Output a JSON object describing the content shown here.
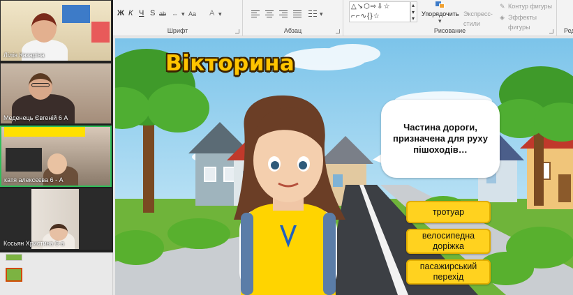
{
  "video_call": {
    "participants": [
      {
        "name": "Лілія Казаріна"
      },
      {
        "name": "Меденець Євгеній 6 А"
      },
      {
        "name": "катя алексєєва 6 - А"
      },
      {
        "name": "Косьян Христина 6-а"
      }
    ],
    "colors": {
      "active_speaker_border": "#2fbf5a"
    }
  },
  "ribbon": {
    "font_group": {
      "label": "Шрифт",
      "glyphs": [
        "Ж",
        "К",
        "Ч",
        "S",
        "ab",
        "А"
      ]
    },
    "paragraph_group": {
      "label": "Абзац"
    },
    "drawing_group": {
      "label": "Рисование",
      "arrange_label": "Упорядочить",
      "express_styles_label": "Экспресс-стили",
      "shape_outline_label": "Контур фигуры",
      "shape_effects_label": "Эффекты фигуры"
    },
    "truncated_group_label": "Ред"
  },
  "slide": {
    "title": "Вікторина",
    "question": "Частина дороги, призначена для руху пішоходів…",
    "answers": [
      "тротуар",
      "велосипедна доріжка",
      "пасажирський перехід"
    ],
    "colors": {
      "title": "#ffc400",
      "answer_fill": "#ffd21f",
      "answer_border": "#e1ad00"
    }
  }
}
